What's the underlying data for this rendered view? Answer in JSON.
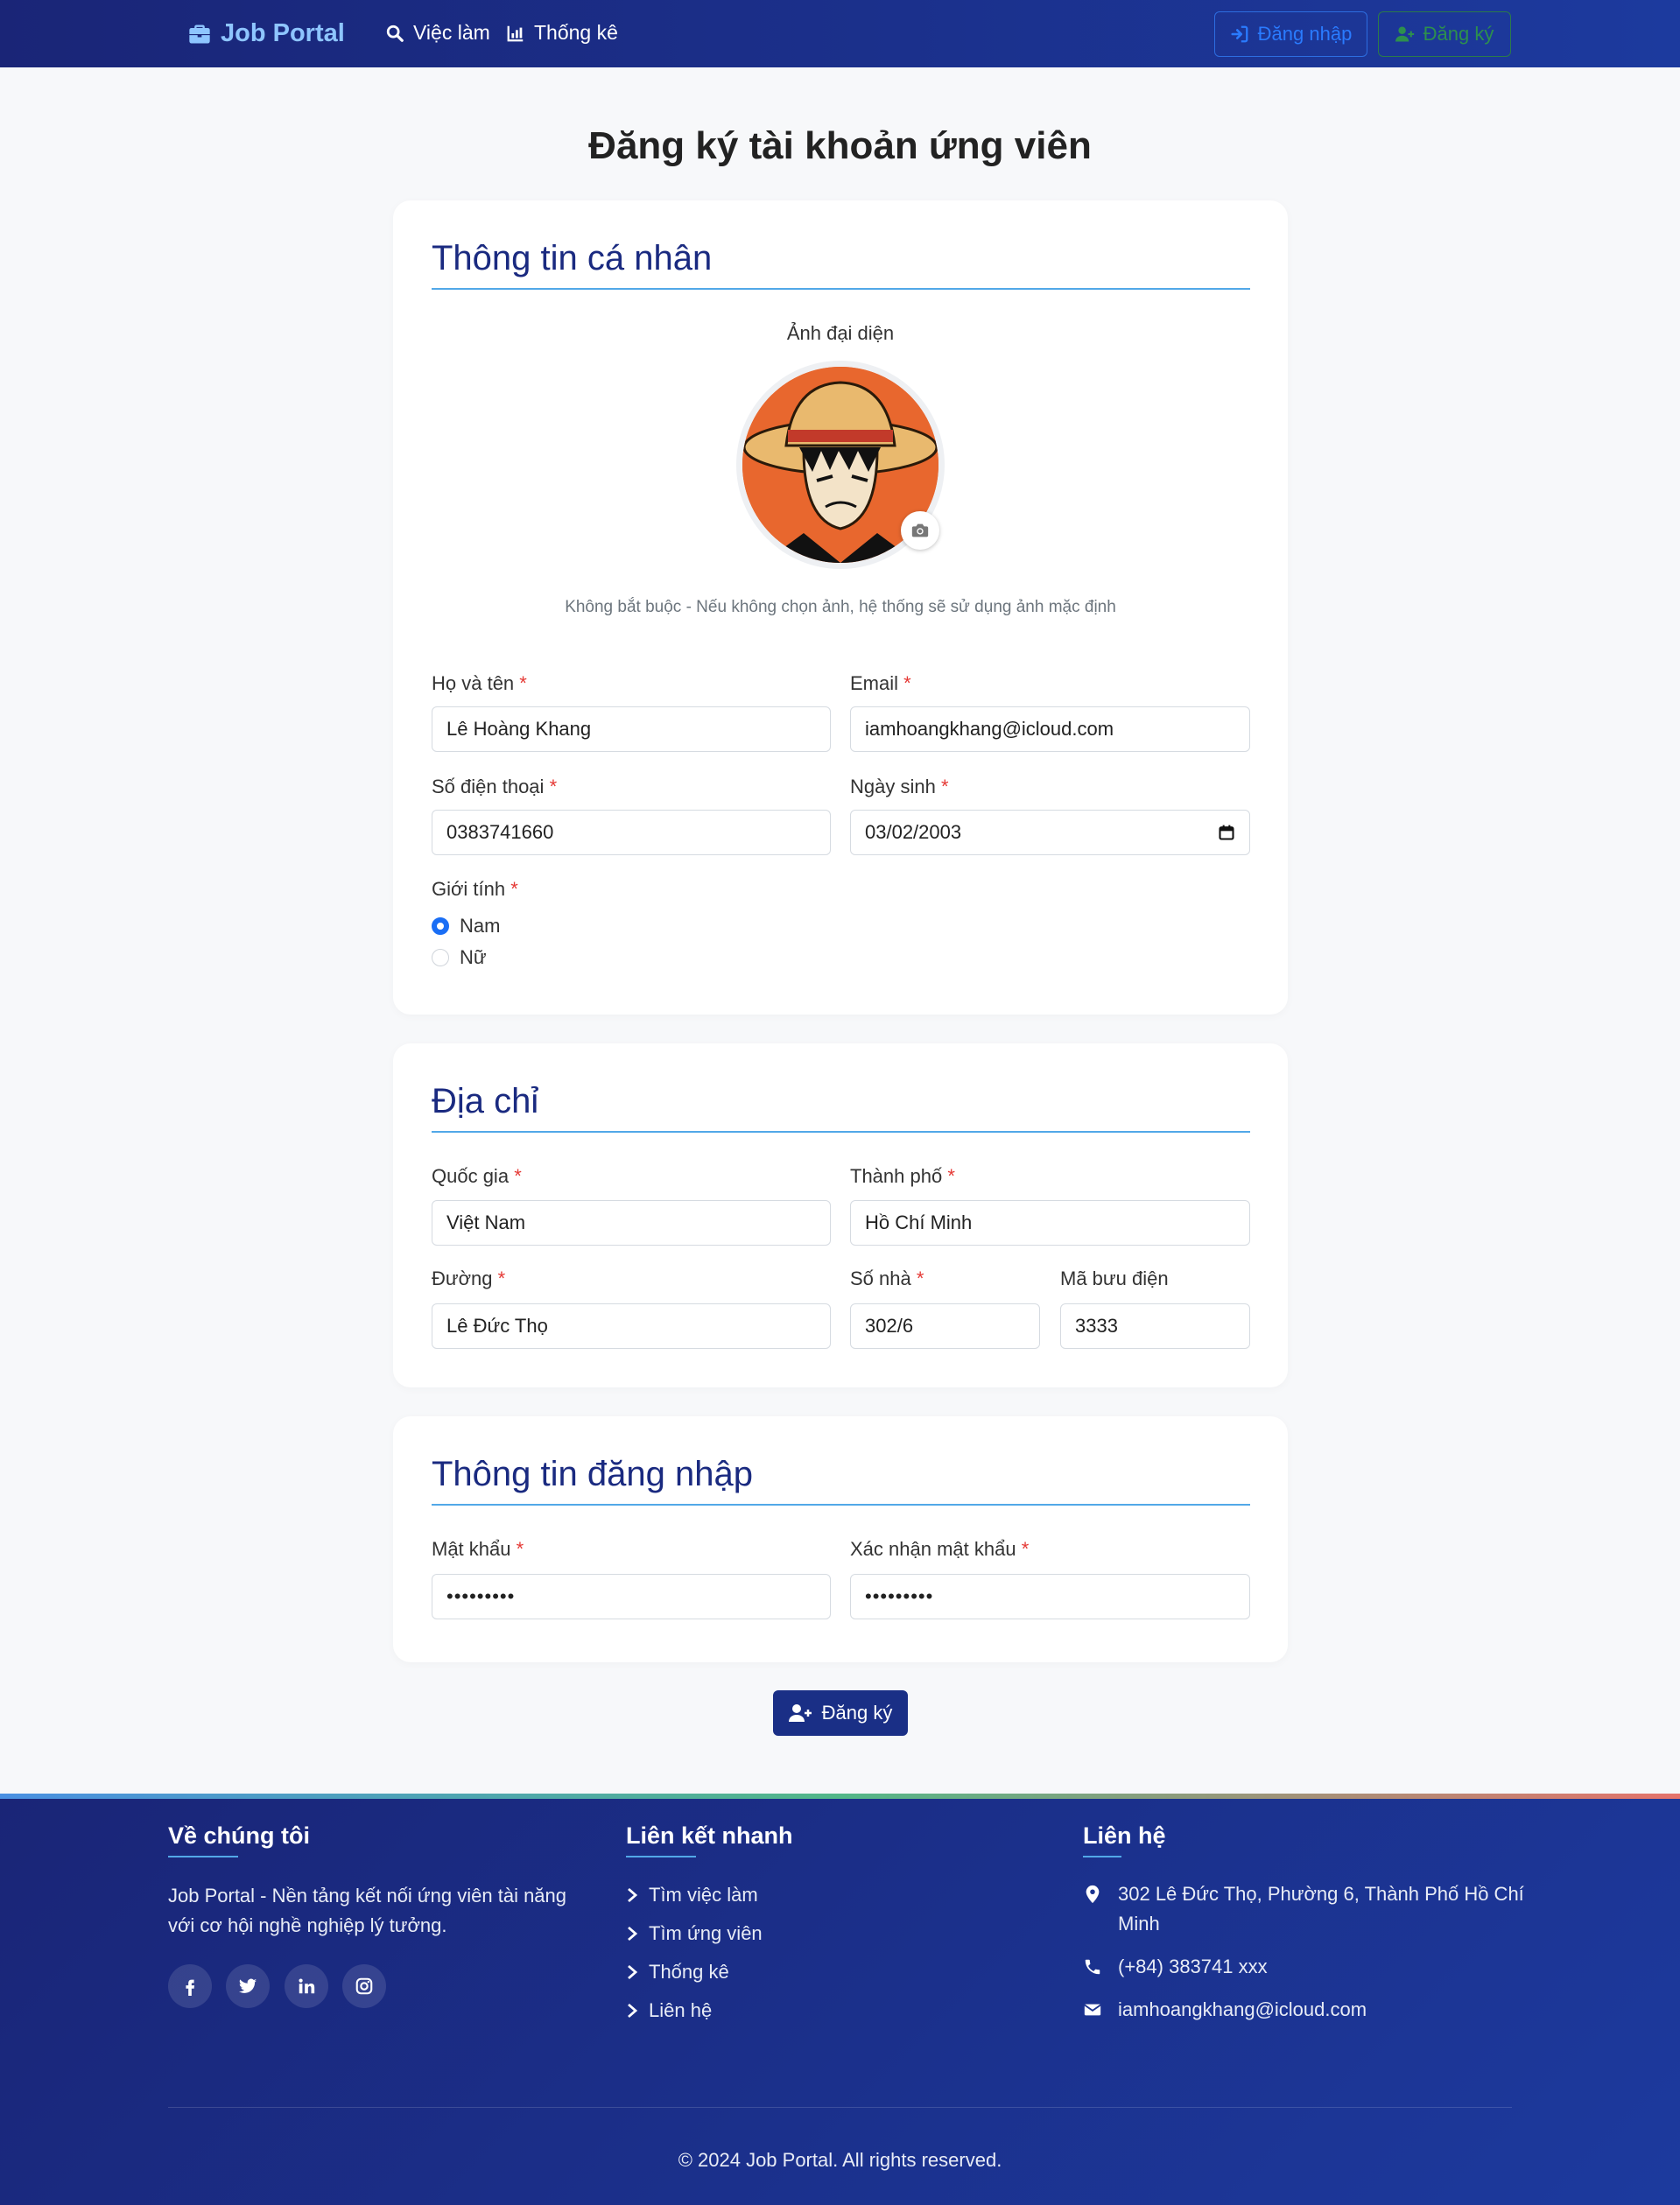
{
  "nav": {
    "brand": "Job Portal",
    "links": [
      "Việc làm",
      "Thống kê"
    ],
    "login": "Đăng nhập",
    "signup": "Đăng ký"
  },
  "page_title": "Đăng ký tài khoản ứng viên",
  "personal": {
    "title": "Thông tin cá nhân",
    "avatar_label": "Ảnh đại diện",
    "avatar_hint": "Không bắt buộc - Nếu không chọn ảnh, hệ thống sẽ sử dụng ảnh mặc định",
    "fullname_label": "Họ và tên",
    "fullname_value": "Lê Hoàng Khang",
    "email_label": "Email",
    "email_value": "iamhoangkhang@icloud.com",
    "phone_label": "Số điện thoại",
    "phone_value": "0383741660",
    "dob_label": "Ngày sinh",
    "dob_value": "03/02/2003",
    "gender_label": "Giới tính",
    "gender_options": [
      "Nam",
      "Nữ"
    ],
    "gender_selected": "Nam",
    "required_mark": "*"
  },
  "address": {
    "title": "Địa chỉ",
    "country_label": "Quốc gia",
    "country_value": "Việt Nam",
    "city_label": "Thành phố",
    "city_value": "Hồ Chí Minh",
    "street_label": "Đường",
    "street_value": "Lê Đức Thọ",
    "house_label": "Số nhà",
    "house_value": "302/6",
    "postal_label": "Mã bưu điện",
    "postal_value": "3333"
  },
  "login_info": {
    "title": "Thông tin đăng nhập",
    "password_label": "Mật khẩu",
    "password_value": "•••••••••",
    "confirm_label": "Xác nhận mật khẩu",
    "confirm_value": "•••••••••"
  },
  "submit_label": "Đăng ký",
  "footer": {
    "about_title": "Về chúng tôi",
    "about_text_1": "Job Portal - Nền tảng kết nối ứng viên tài năng",
    "about_text_2": "với cơ hội nghề nghiệp lý tưởng.",
    "social_icons": [
      "facebook-icon",
      "twitter-icon",
      "linkedin-icon",
      "instagram-icon"
    ],
    "links_title": "Liên kết nhanh",
    "links": [
      "Tìm việc làm",
      "Tìm ứng viên",
      "Thống kê",
      "Liên hệ"
    ],
    "contact_title": "Liên hệ",
    "address_1": "302 Lê Đức Thọ, Phường 6, Thành Phố Hồ Chí",
    "address_2": "Minh",
    "phone": "(+84) 383741 xxx",
    "email": "iamhoangkhang@icloud.com",
    "copyright": "© 2024 Job Portal. All rights reserved."
  },
  "colors": {
    "nav_bg": "#1a2577",
    "accent_blue": "#1a2f86",
    "section_title": "#1a2a80",
    "required": "#e53935",
    "radio_on": "#1a6ef5"
  }
}
